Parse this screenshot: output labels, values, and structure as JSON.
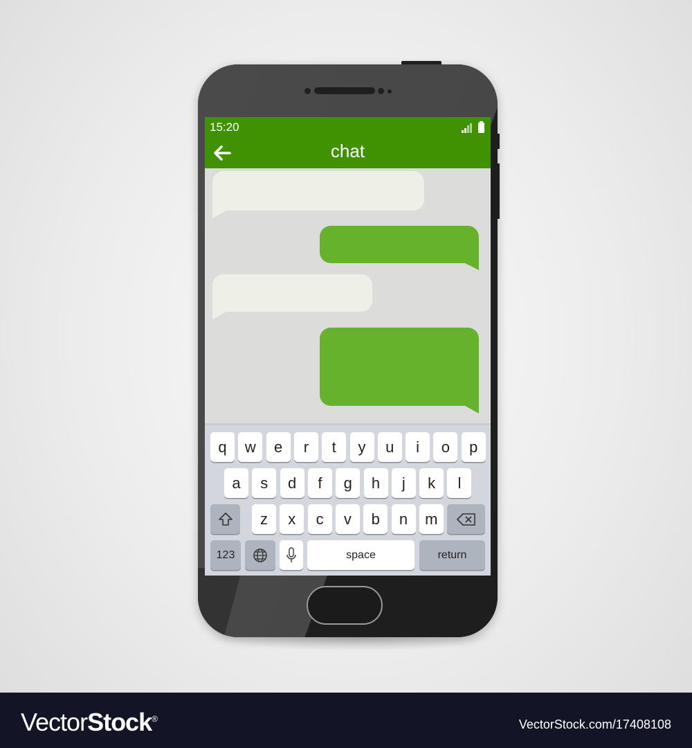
{
  "status_bar": {
    "time": "15:20",
    "signal_icon": "signal-icon",
    "battery_icon": "battery-icon"
  },
  "app_bar": {
    "title": "chat",
    "back_icon": "arrow-left-icon"
  },
  "colors": {
    "app_bar": "#409203",
    "sent_bubble": "#67b22d",
    "received_bubble": "#eef0e8",
    "chat_bg": "#dcdcda",
    "keyboard_bg": "#d3d6dc"
  },
  "messages": [
    {
      "direction": "received",
      "text": ""
    },
    {
      "direction": "sent",
      "text": ""
    },
    {
      "direction": "received",
      "text": ""
    },
    {
      "direction": "sent",
      "text": ""
    }
  ],
  "keyboard": {
    "row1": [
      "q",
      "w",
      "e",
      "r",
      "t",
      "y",
      "u",
      "i",
      "o",
      "p"
    ],
    "row2": [
      "a",
      "s",
      "d",
      "f",
      "g",
      "h",
      "j",
      "k",
      "l"
    ],
    "row3": [
      "z",
      "x",
      "c",
      "v",
      "b",
      "n",
      "m"
    ],
    "numbers_label": "123",
    "space_label": "space",
    "return_label": "return"
  },
  "watermark": {
    "logo_light": "Vector",
    "logo_bold": "Stock",
    "logo_reg": "®",
    "url": "VectorStock.com/17408108"
  }
}
